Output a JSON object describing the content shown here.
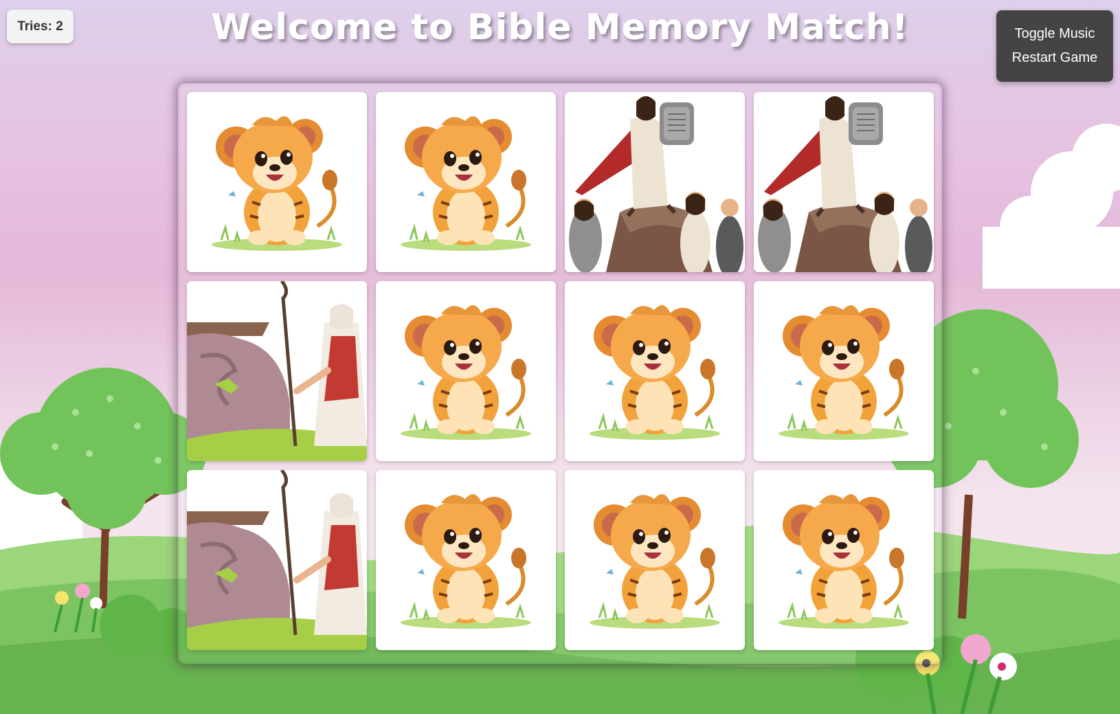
{
  "hud": {
    "tries_label": "Tries: 2"
  },
  "header": {
    "title": "Welcome to Bible Memory Match!"
  },
  "controls": {
    "toggle_music_label": "Toggle Music",
    "restart_label": "Restart Game"
  },
  "board": {
    "rows": 3,
    "columns": 4,
    "cards": [
      {
        "image": "lion-cub"
      },
      {
        "image": "lion-cub"
      },
      {
        "image": "moses-ten-commandments"
      },
      {
        "image": "moses-ten-commandments"
      },
      {
        "image": "moses-staff-rock"
      },
      {
        "image": "lion-cub"
      },
      {
        "image": "lion-cub"
      },
      {
        "image": "lion-cub"
      },
      {
        "image": "moses-staff-rock"
      },
      {
        "image": "lion-cub"
      },
      {
        "image": "lion-cub"
      },
      {
        "image": "lion-cub"
      }
    ]
  },
  "colors": {
    "sky_top": "#ddd0ea",
    "sky_pink": "#e4b8d8",
    "grass": "#7cc462",
    "panel": "#444444"
  }
}
